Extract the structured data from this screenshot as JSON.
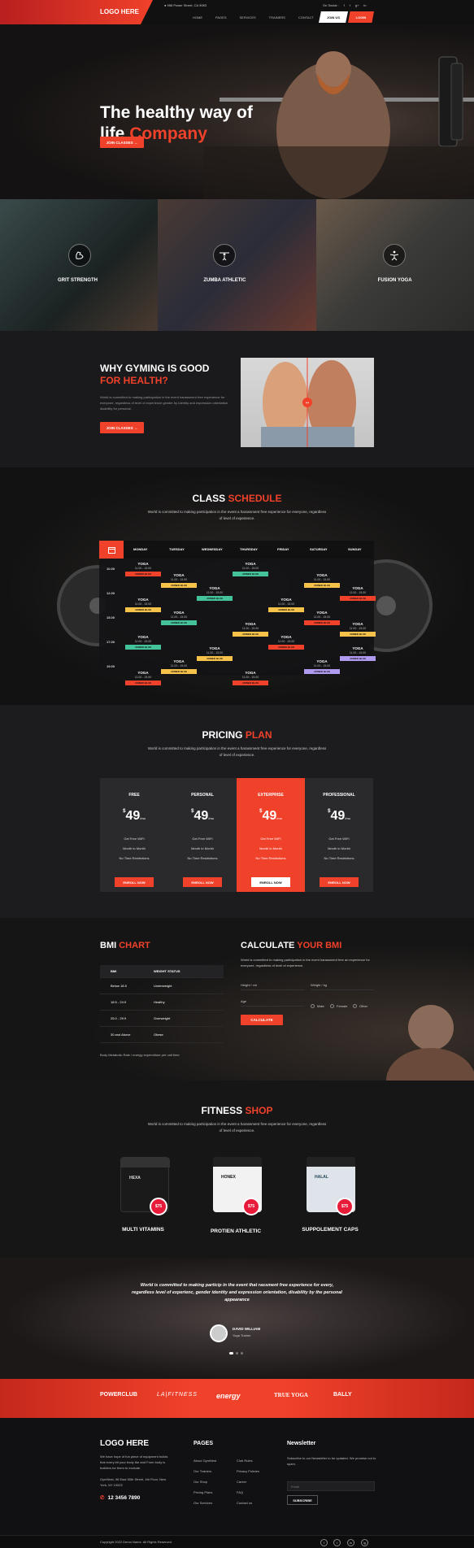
{
  "header": {
    "logo": "LOGO HERE",
    "address": "958 Power Street, CA 9083",
    "nav": [
      "HOME",
      "PAGES",
      "SERVICES",
      "TRAINERS",
      "CONTACT"
    ],
    "follow_label": "On Social :",
    "social": [
      "f",
      "t",
      "g+",
      "in"
    ],
    "join_label": "JOIN US",
    "login_label": "LOGIN"
  },
  "hero": {
    "title_line1": "The healthy way of",
    "title_line2_plain": "life ",
    "title_line2_accent": "Company",
    "button": "JOIN CLASSES →"
  },
  "tiles": [
    {
      "label": "GRIT STRENGTH",
      "icon": "flexed-arm-icon"
    },
    {
      "label": "ZUMBA ATHLETIC",
      "icon": "weightlifter-icon"
    },
    {
      "label": "FUSION YOGA",
      "icon": "yoga-pose-icon"
    }
  ],
  "why": {
    "title_line1": "WHY GYMING IS GOOD",
    "title_line2": "FOR HEALTH?",
    "text": "World is committed to making participation in the event harassment free experience for everyone, regardless of level of experience gender by Identity and expression orientation disability for personal.",
    "button": "JOIN CLASSES →"
  },
  "schedule": {
    "title_plain": "CLASS ",
    "title_accent": "SCHEDULE",
    "subtitle": "World is committed to making participation in the event a harassment free experience for everyone, regardless of level of experience.",
    "days": [
      "MONDAY",
      "TUESDAY",
      "WEDNESDAY",
      "THURSDAY",
      "FRIDAY",
      "SATURDAY",
      "SUNDAY"
    ],
    "times": [
      "10.00",
      "12.00",
      "15.00",
      "17.00",
      "19.00"
    ],
    "class_name": "YOGA",
    "class_time": "11.00 - 15.00",
    "join_label": "JOINED BLUE"
  },
  "pricing": {
    "title_plain": "PRICING ",
    "title_accent": "PLAN",
    "subtitle": "World is committed to making participation in the event a harassment free experience for everyone, regardless of level of experience.",
    "plans": [
      {
        "name": "FREE",
        "price": "49",
        "currency": "$",
        "per": "/mo",
        "features": [
          "Get Free WIFI",
          "Month to Month",
          "No Time Restrictions"
        ],
        "button": "ENROLL NOW"
      },
      {
        "name": "PERSONAL",
        "price": "49",
        "currency": "$",
        "per": "/mo",
        "features": [
          "Get Free WIFI",
          "Month to Month",
          "No Time Restrictions"
        ],
        "button": "ENROLL NOW"
      },
      {
        "name": "EXTERPRISE",
        "price": "49",
        "currency": "$",
        "per": "/mo",
        "features": [
          "Get Free WIFI",
          "Month to Month",
          "No Time Restrictions"
        ],
        "button": "ENROLL NOW"
      },
      {
        "name": "PROFESSIONAL",
        "price": "49",
        "currency": "$",
        "per": "/mo",
        "features": [
          "Get Free WIFI",
          "Month to Month",
          "No Time Restrictions"
        ],
        "button": "ENROLL NOW"
      }
    ]
  },
  "bmi": {
    "chart_title_plain": "BMI ",
    "chart_title_accent": "CHART",
    "table_head": [
      "BMI",
      "WEIGHT STATUS"
    ],
    "rows": [
      [
        "Below 18.5",
        "Underweight"
      ],
      [
        "18.5 - 24.9",
        "Healthy"
      ],
      [
        "25.0 - 29.9",
        "Overweight"
      ],
      [
        "30 and Above",
        "Obese"
      ]
    ],
    "footnote": "Body Metabolic Rate / energy expenditure per unit time",
    "calc_title_plain": "CALCULATE ",
    "calc_title_accent": "YOUR BMI",
    "calc_text": "World is committed to making participation in the event harassment free an experience for everyone, regardless of level of experience.",
    "height_label": "Height / cm",
    "weight_label": "Weight / kg",
    "age_label": "Age",
    "genders": [
      "Male",
      "Female",
      "Other"
    ],
    "calc_button": "CALCULATE"
  },
  "shop": {
    "title_plain": "FITNESS ",
    "title_accent": "SHOP",
    "subtitle": "World is committed to making participation in the event a harassment free experience for everyone, regardless of level of experience.",
    "products": [
      {
        "name": "MULTI VITAMINS",
        "brand": "HEXA",
        "price": "$75"
      },
      {
        "name": "PROTIEN ATHLETIC",
        "brand": "HONEX",
        "price": "$75"
      },
      {
        "name": "SUPPOLEMENT CAPS",
        "brand": "HALAL",
        "price": "$75"
      }
    ]
  },
  "testimonial": {
    "quote": "World is committed to making particip in the event that rassment free experience for every, regardless level of experienc, gender identity and expression orientation, disability by the personal appearance",
    "name": "DAVID WILLIAM",
    "role": "Yoga Trainer"
  },
  "brands": [
    "POWERCLUB",
    "LA|FITNESS",
    "energy",
    "TRUE YOGA",
    "BALLY"
  ],
  "footer": {
    "logo": "LOGO HERE",
    "about": "We have hope of fun piece of equipment builds that every bit your body the and From body is builders for them to exclude.",
    "address": "GymNest, 96 East 50th Street, 4th Floor, New York, NY 10022",
    "phone": "12 3456 7890",
    "pages_title": "PAGES",
    "pages_col1": [
      "About GymNest",
      "Our Trainers",
      "Our Shop",
      "Pricing Plans",
      "Our Services"
    ],
    "pages_col2": [
      "Club Rules",
      "Privacy Policies",
      "Career",
      "FAQ",
      "Contact us"
    ],
    "newsletter_title": "Newsletter",
    "newsletter_text": "Subscribe to our Newsletter to be updated. We promise not to spam.",
    "email_placeholder": "Email",
    "subscribe": "SUBSCRIBE",
    "copyright": "Copyright 2022 Demo Name. All Rights Reserved.",
    "social": [
      "f",
      "t",
      "in",
      "ig"
    ]
  },
  "colors": {
    "accent": "#f0412a",
    "dark": "#151517"
  }
}
